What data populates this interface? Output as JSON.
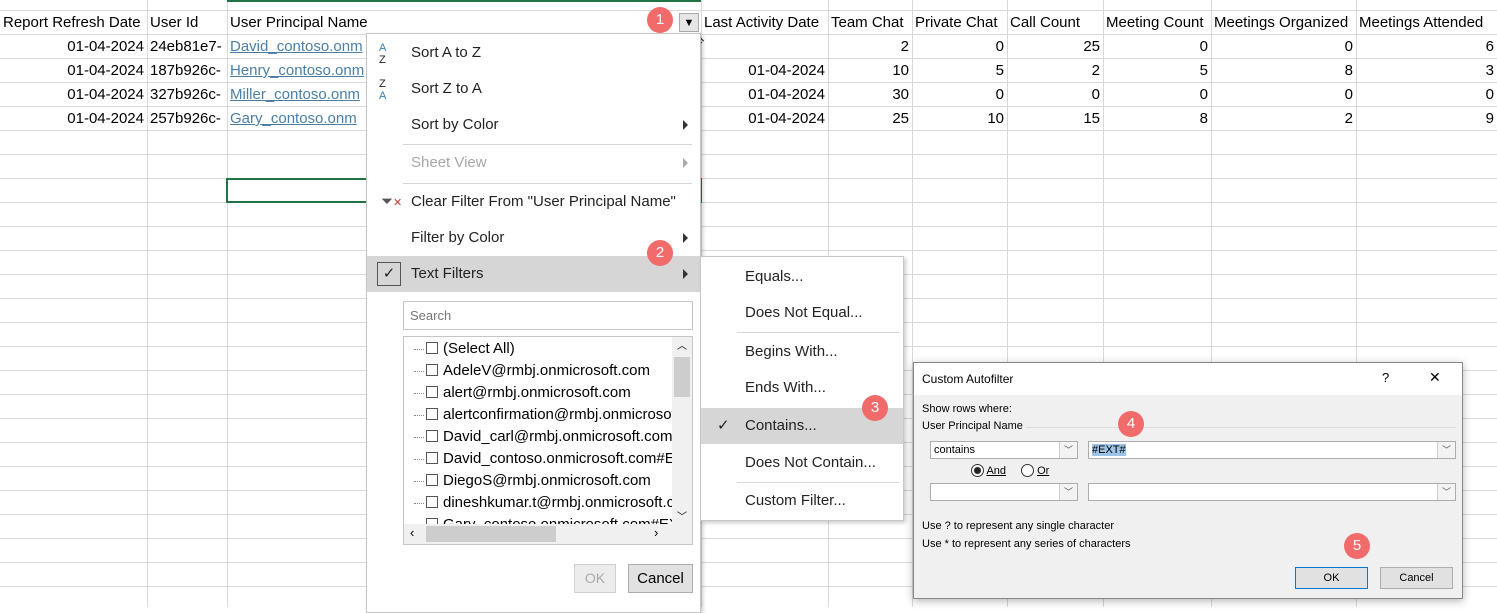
{
  "sheet": {
    "headers": [
      "Report Refresh Date",
      "User Id",
      "User Principal Name",
      "Last Activity Date",
      "Team Chat",
      "Private Chat",
      "Call Count",
      "Meeting Count",
      "Meetings Organized",
      "Meetings Attended"
    ],
    "rows": [
      [
        "01-04-2024",
        "24eb81e7-",
        "David_contoso.onm",
        "",
        "2",
        "0",
        "25",
        "0",
        "0",
        "6"
      ],
      [
        "01-04-2024",
        "187b926c-",
        "Henry_contoso.onm",
        "01-04-2024",
        "10",
        "5",
        "2",
        "5",
        "8",
        "3"
      ],
      [
        "01-04-2024",
        "327b926c-",
        "Miller_contoso.onm",
        "01-04-2024",
        "30",
        "0",
        "0",
        "0",
        "0",
        "0"
      ],
      [
        "01-04-2024",
        "257b926c-",
        "Gary_contoso.onm",
        "01-04-2024",
        "25",
        "10",
        "15",
        "8",
        "2",
        "9"
      ]
    ]
  },
  "filter_menu": {
    "sort_az": "Sort A to Z",
    "sort_za": "Sort Z to A",
    "sort_color": "Sort by Color",
    "sheet_view": "Sheet View",
    "clear_filter": "Clear Filter From \"User Principal Name\"",
    "filter_color": "Filter by Color",
    "text_filters": "Text Filters",
    "search_placeholder": "Search",
    "items": [
      "(Select All)",
      "AdeleV@rmbj.onmicrosoft.com",
      "alert@rmbj.onmicrosoft.com",
      "alertconfirmation@rmbj.onmicrosoft.com",
      "David_carl@rmbj.onmicrosoft.com",
      "David_contoso.onmicrosoft.com#EXT#",
      "DiegoS@rmbj.onmicrosoft.com",
      "dineshkumar.t@rmbj.onmicrosoft.com",
      "Gary_contoso.onmicrosoft.com#EXT#"
    ],
    "ok": "OK",
    "cancel": "Cancel"
  },
  "text_filters_menu": [
    "Equals...",
    "Does Not Equal...",
    "Begins With...",
    "Ends With...",
    "Contains...",
    "Does Not Contain...",
    "Custom Filter..."
  ],
  "dialog": {
    "title": "Custom Autofilter",
    "help": "?",
    "close": "✕",
    "show_rows": "Show rows where:",
    "field": "User Principal Name",
    "op1": "contains",
    "value1": "#EXT#",
    "and": "And",
    "or": "Or",
    "op2": "",
    "value2": "",
    "hint1": "Use ? to represent any single character",
    "hint2": "Use * to represent any series of characters",
    "ok": "OK",
    "cancel": "Cancel"
  },
  "badges": [
    "1",
    "2",
    "3",
    "4",
    "5"
  ],
  "colors": {
    "badge": "#f26b6b",
    "link": "#4a7ea8",
    "selection_green": "#217346"
  }
}
